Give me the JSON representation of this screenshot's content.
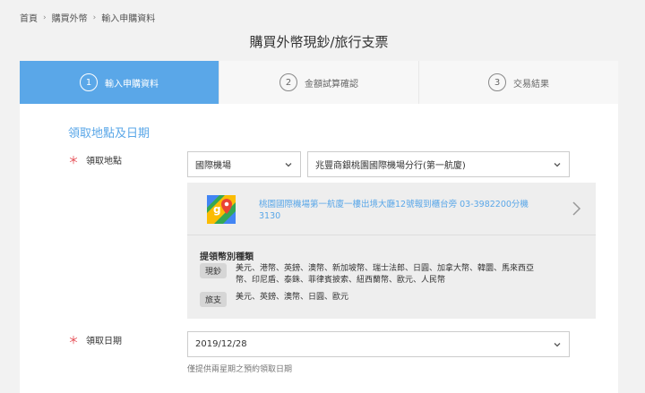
{
  "breadcrumb": [
    "首頁",
    "購買外幣",
    "輸入申購資料"
  ],
  "page_title": "購買外幣現鈔/旅行支票",
  "steps": [
    {
      "num": "1",
      "label": "輸入申購資料"
    },
    {
      "num": "2",
      "label": "金額試算確認"
    },
    {
      "num": "3",
      "label": "交易結果"
    }
  ],
  "section_title": "領取地點及日期",
  "pickup_location": {
    "required_mark": "＊",
    "label": "領取地點",
    "location_type": "國際機場",
    "branch": "兆豐商銀桃園國際機場分行(第一航廈)"
  },
  "map_link": "桃園國際機場第一航廈一樓出境大廳12號報到櫃台旁 03-3982200分機3130",
  "currency_types": {
    "title": "提領幣別種類",
    "cash": {
      "badge": "現鈔",
      "list": "美元、港幣、英鎊、澳幣、新加坡幣、瑞士法郎、日圓、加拿大幣、韓圜、馬來西亞幣、印尼盾、泰銖、菲律賓披索、紐西蘭幣、歐元、人民幣"
    },
    "cheque": {
      "badge": "旅支",
      "list": "美元、英鎊、澳幣、日圓、歐元"
    }
  },
  "pickup_date": {
    "required_mark": "＊",
    "label": "領取日期",
    "value": "2019/12/28",
    "hint": "僅提供兩星期之預約領取日期"
  },
  "colors": {
    "accent": "#5aa7e8",
    "required": "#e5474f"
  }
}
